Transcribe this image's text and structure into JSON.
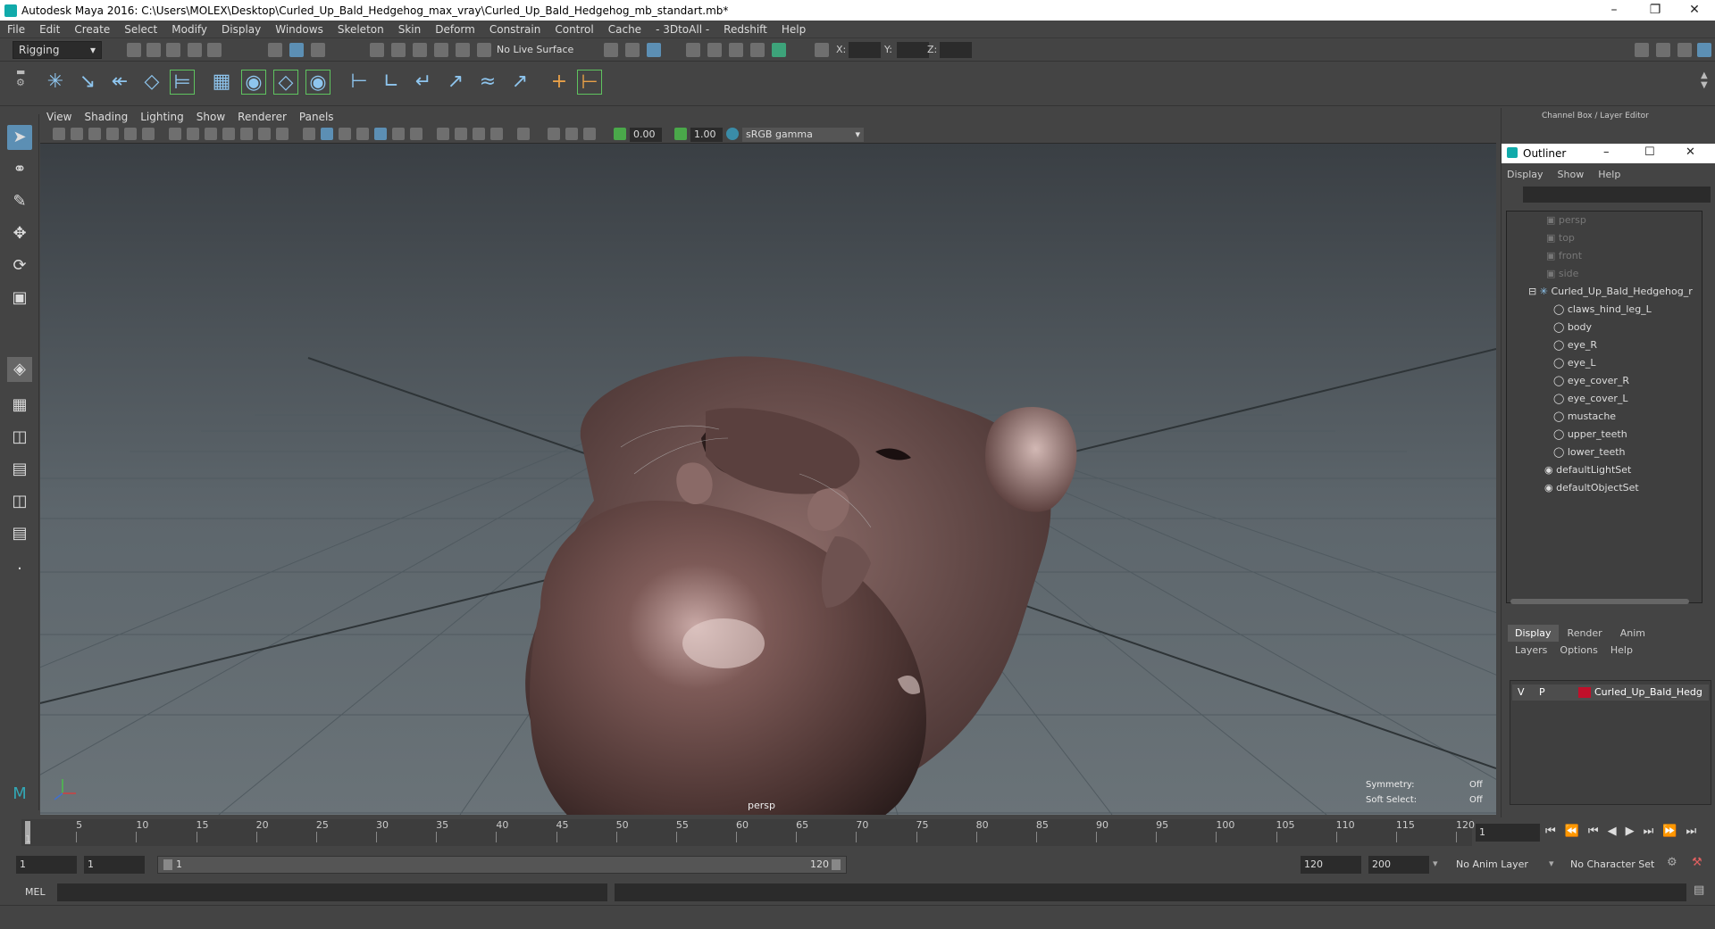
{
  "window": {
    "title": "Autodesk Maya 2016: C:\\Users\\MOLEX\\Desktop\\Curled_Up_Bald_Hedgehog_max_vray\\Curled_Up_Bald_Hedgehog_mb_standart.mb*"
  },
  "menubar": [
    "File",
    "Edit",
    "Create",
    "Select",
    "Modify",
    "Display",
    "Windows",
    "Skeleton",
    "Skin",
    "Deform",
    "Constrain",
    "Control",
    "Cache",
    "- 3DtoAll -",
    "Redshift",
    "Help"
  ],
  "status": {
    "menuset": "Rigging",
    "live_surface": "No Live Surface",
    "x_label": "X:",
    "y_label": "Y:",
    "z_label": "Z:"
  },
  "viewport": {
    "menus": [
      "View",
      "Shading",
      "Lighting",
      "Show",
      "Renderer",
      "Panels"
    ],
    "exposure": "0.00",
    "gamma": "1.00",
    "color_space": "sRGB gamma",
    "camera_label": "persp",
    "symmetry_label": "Symmetry:",
    "symmetry_value": "Off",
    "soft_select_label": "Soft Select:",
    "soft_select_value": "Off"
  },
  "channel_box": {
    "title": "Channel Box / Layer Editor"
  },
  "outliner": {
    "title": "Outliner",
    "menus": [
      "Display",
      "Show",
      "Help"
    ],
    "cameras": [
      "persp",
      "top",
      "front",
      "side"
    ],
    "root": "Curled_Up_Bald_Hedgehog_r",
    "children": [
      "claws_hind_leg_L",
      "body",
      "eye_R",
      "eye_L",
      "eye_cover_R",
      "eye_cover_L",
      "mustache",
      "upper_teeth",
      "lower_teeth"
    ],
    "sets": [
      "defaultLightSet",
      "defaultObjectSet"
    ]
  },
  "layer_editor": {
    "tabs": [
      "Display",
      "Render",
      "Anim"
    ],
    "menus": [
      "Layers",
      "Options",
      "Help"
    ],
    "layer": {
      "v": "V",
      "p": "P",
      "name": "Curled_Up_Bald_Hedg",
      "color": "#c0102a"
    }
  },
  "timeline": {
    "ticks": [
      "5",
      "10",
      "15",
      "20",
      "25",
      "30",
      "35",
      "40",
      "45",
      "50",
      "55",
      "60",
      "65",
      "70",
      "75",
      "80",
      "85",
      "90",
      "95",
      "100",
      "105",
      "110",
      "115",
      "120"
    ],
    "first_tick": "1",
    "current_frame": "1",
    "range_start": "1",
    "playback_start": "1",
    "range_bar_start": "1",
    "range_bar_end": "120",
    "playback_end": "120",
    "range_end": "200",
    "anim_layer": "No Anim Layer",
    "character_set": "No Character Set"
  },
  "cmdline": {
    "label": "MEL"
  }
}
